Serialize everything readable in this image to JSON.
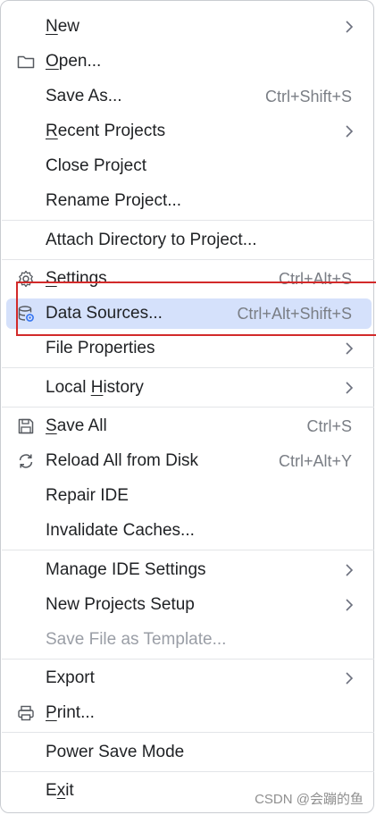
{
  "menu": {
    "items": [
      {
        "prefix": "",
        "underline": "N",
        "rest": "ew",
        "shortcut": "",
        "submenu": true,
        "icon": ""
      },
      {
        "prefix": "",
        "underline": "O",
        "rest": "pen...",
        "shortcut": "",
        "submenu": false,
        "icon": "folder-icon"
      },
      {
        "prefix": "Save As...",
        "underline": "",
        "rest": "",
        "shortcut": "Ctrl+Shift+S",
        "submenu": false,
        "icon": ""
      },
      {
        "prefix": "",
        "underline": "R",
        "rest": "ecent Projects",
        "shortcut": "",
        "submenu": true,
        "icon": ""
      },
      {
        "prefix": "Close Project",
        "underline": "",
        "rest": "",
        "shortcut": "",
        "submenu": false,
        "icon": ""
      },
      {
        "prefix": "Rename Project...",
        "underline": "",
        "rest": "",
        "shortcut": "",
        "submenu": false,
        "icon": ""
      },
      {
        "prefix": "Attach Directory to Project...",
        "underline": "",
        "rest": "",
        "shortcut": "",
        "submenu": false,
        "icon": ""
      },
      {
        "prefix": "",
        "underline": "S",
        "rest": "ettings...",
        "shortcut": "Ctrl+Alt+S",
        "submenu": false,
        "icon": "gear-icon"
      },
      {
        "prefix": "Data Sources...",
        "underline": "",
        "rest": "",
        "shortcut": "Ctrl+Alt+Shift+S",
        "submenu": false,
        "icon": "database-icon"
      },
      {
        "prefix": "File Properties",
        "underline": "",
        "rest": "",
        "shortcut": "",
        "submenu": true,
        "icon": ""
      },
      {
        "prefix": "Local ",
        "underline": "H",
        "rest": "istory",
        "shortcut": "",
        "submenu": true,
        "icon": ""
      },
      {
        "prefix": "",
        "underline": "S",
        "rest": "ave All",
        "shortcut": "Ctrl+S",
        "submenu": false,
        "icon": "save-icon"
      },
      {
        "prefix": "Reload All from Disk",
        "underline": "",
        "rest": "",
        "shortcut": "Ctrl+Alt+Y",
        "submenu": false,
        "icon": "reload-icon"
      },
      {
        "prefix": "Repair IDE",
        "underline": "",
        "rest": "",
        "shortcut": "",
        "submenu": false,
        "icon": ""
      },
      {
        "prefix": "Invalidate Caches...",
        "underline": "",
        "rest": "",
        "shortcut": "",
        "submenu": false,
        "icon": ""
      },
      {
        "prefix": "Manage IDE Settings",
        "underline": "",
        "rest": "",
        "shortcut": "",
        "submenu": true,
        "icon": ""
      },
      {
        "prefix": "New Projects Setup",
        "underline": "",
        "rest": "",
        "shortcut": "",
        "submenu": true,
        "icon": ""
      },
      {
        "prefix": "Save File as Template...",
        "underline": "",
        "rest": "",
        "shortcut": "",
        "submenu": false,
        "icon": "",
        "disabled": true
      },
      {
        "prefix": "Export",
        "underline": "",
        "rest": "",
        "shortcut": "",
        "submenu": true,
        "icon": ""
      },
      {
        "prefix": "",
        "underline": "P",
        "rest": "rint...",
        "shortcut": "",
        "submenu": false,
        "icon": "printer-icon"
      },
      {
        "prefix": "Power Save Mode",
        "underline": "",
        "rest": "",
        "shortcut": "",
        "submenu": false,
        "icon": ""
      },
      {
        "prefix": "E",
        "underline": "x",
        "rest": "it",
        "shortcut": "",
        "submenu": false,
        "icon": ""
      }
    ],
    "selected_index": 8
  },
  "watermark": "CSDN @会蹦的鱼",
  "colors": {
    "selection": "#d5e1fb",
    "highlight_box": "#d22a2a",
    "icon_blue": "#3574f0"
  }
}
